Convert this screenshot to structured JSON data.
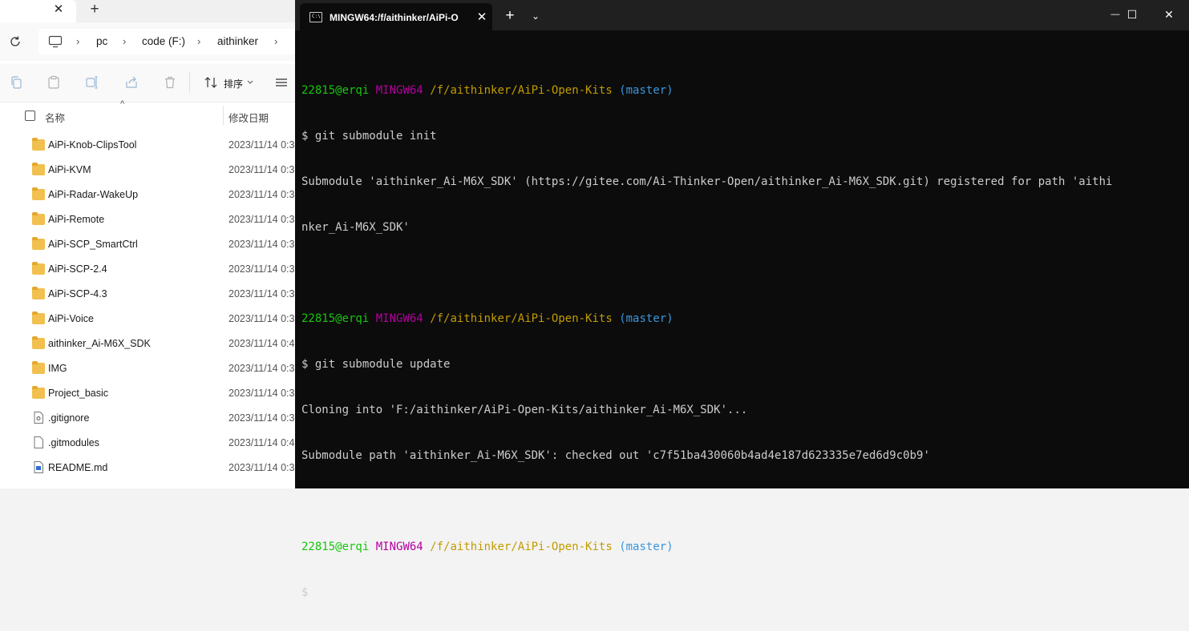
{
  "explorer": {
    "tab_close": "✕",
    "new_tab": "+",
    "breadcrumb": [
      "pc",
      "code (F:)",
      "aithinker"
    ],
    "breadcrumb_sep": "›",
    "toolbar": {
      "sort_label": "排序"
    },
    "columns": {
      "name": "名称",
      "date": "修改日期"
    },
    "items": [
      {
        "name": "AiPi-Knob-ClipsTool",
        "date": "2023/11/14 0:3",
        "type": "folder"
      },
      {
        "name": "AiPi-KVM",
        "date": "2023/11/14 0:3",
        "type": "folder"
      },
      {
        "name": "AiPi-Radar-WakeUp",
        "date": "2023/11/14 0:3",
        "type": "folder"
      },
      {
        "name": "AiPi-Remote",
        "date": "2023/11/14 0:3",
        "type": "folder"
      },
      {
        "name": "AiPi-SCP_SmartCtrl",
        "date": "2023/11/14 0:3",
        "type": "folder"
      },
      {
        "name": "AiPi-SCP-2.4",
        "date": "2023/11/14 0:3",
        "type": "folder"
      },
      {
        "name": "AiPi-SCP-4.3",
        "date": "2023/11/14 0:3",
        "type": "folder"
      },
      {
        "name": "AiPi-Voice",
        "date": "2023/11/14 0:3",
        "type": "folder"
      },
      {
        "name": "aithinker_Ai-M6X_SDK",
        "date": "2023/11/14 0:4",
        "type": "folder"
      },
      {
        "name": "IMG",
        "date": "2023/11/14 0:3",
        "type": "folder"
      },
      {
        "name": "Project_basic",
        "date": "2023/11/14 0:3",
        "type": "folder"
      },
      {
        "name": ".gitignore",
        "date": "2023/11/14 0:3",
        "type": "config"
      },
      {
        "name": ".gitmodules",
        "date": "2023/11/14 0:4",
        "type": "file"
      },
      {
        "name": "README.md",
        "date": "2023/11/14 0:3",
        "type": "markdown"
      }
    ]
  },
  "terminal": {
    "tab_title": "MINGW64:/f/aithinker/AiPi-O",
    "tab_icon_text": "C:\\",
    "tab_close": "✕",
    "new_tab": "+",
    "dropdown": "⌄",
    "win_minimize": "—",
    "win_maximize": "☐",
    "win_close": "✕",
    "prompt": {
      "user": "22815@erqi",
      "system": "MINGW64",
      "path": "/f/aithinker/AiPi-Open-Kits",
      "branch": "(master)"
    },
    "lines": {
      "cmd1": "$ git submodule init",
      "out1a": "Submodule 'aithinker_Ai-M6X_SDK' (https://gitee.com/Ai-Thinker-Open/aithinker_Ai-M6X_SDK.git) registered for path 'aithi",
      "out1b": "nker_Ai-M6X_SDK'",
      "cmd2": "$ git submodule update",
      "out2a": "Cloning into 'F:/aithinker/AiPi-Open-Kits/aithinker_Ai-M6X_SDK'...",
      "out2b": "Submodule path 'aithinker_Ai-M6X_SDK': checked out 'c7f51ba430060b4ad4e187d623335e7ed6d9c0b9'",
      "cmd3": "$"
    }
  }
}
